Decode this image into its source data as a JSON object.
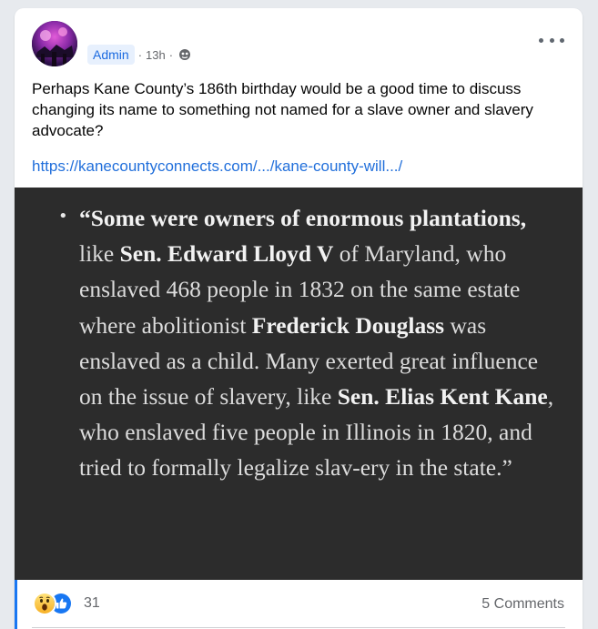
{
  "post": {
    "badge": "Admin",
    "separator": "·",
    "time": "13h",
    "separator2": "·",
    "privacy_icon": "globe-icon",
    "menu_icon": "more-options-icon",
    "text": "Perhaps Kane County’s 186th birthday would be a good time to discuss changing its name to something not named for a slave owner and slavery advocate?",
    "link": "https://kanecountyconnects.com/.../kane-county-will.../"
  },
  "image": {
    "bullet": "•",
    "quote": [
      {
        "t": "“Some were owners of enormous plantations,",
        "b": true
      },
      {
        "t": " like ",
        "b": false
      },
      {
        "t": "Sen. Edward Lloyd V",
        "b": true
      },
      {
        "t": " of Maryland, who enslaved 468 people in 1832 on the same estate where abolitionist ",
        "b": false
      },
      {
        "t": "Frederick Douglass",
        "b": true
      },
      {
        "t": " was enslaved as a child. Many exerted great influence on the issue of slavery, like ",
        "b": false
      },
      {
        "t": "Sen. Elias Kent Kane",
        "b": true
      },
      {
        "t": ", who enslaved five people in Illinois in 1820, and tried to formally legalize slav-ery in the state.”",
        "b": false
      }
    ]
  },
  "footer": {
    "reaction_icons": [
      "wow-icon",
      "like-icon"
    ],
    "reaction_count": "31",
    "comments": "5 Comments"
  },
  "colors": {
    "accent": "#1877f2",
    "badge_bg": "#e7f0fd",
    "badge_text": "#1b6ae0",
    "link": "#216fdb",
    "image_bg": "#2c2c2c"
  }
}
